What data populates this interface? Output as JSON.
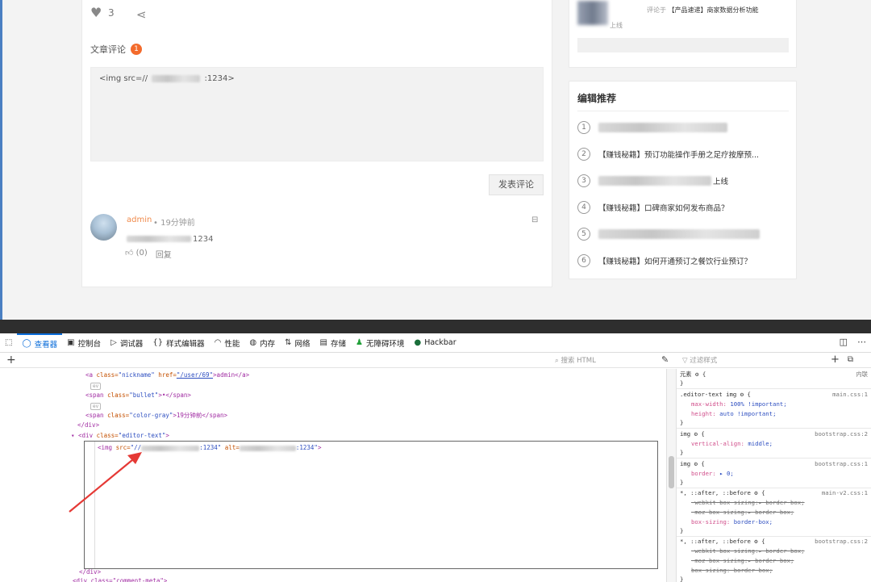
{
  "article": {
    "like_count": "3",
    "comments_title": "文章评论",
    "comments_badge": "1",
    "comment_input_prefix": "<img src=//",
    "comment_input_suffix": ":1234>",
    "submit_label": "发表评论",
    "comment": {
      "author": "admin",
      "time": "• 19分钟前",
      "text_suffix": "1234",
      "like_label": "(0)",
      "reply_label": "回复"
    }
  },
  "sidebar": {
    "recent_comment": {
      "action": "评论于",
      "link": "【产品速递】商家数据分析功能",
      "link_tail": "上线"
    },
    "recommend_title": "编辑推荐",
    "items": [
      {
        "num": "1",
        "title": ""
      },
      {
        "num": "2",
        "title": "【赚钱秘籍】预订功能操作手册之足疗按摩预..."
      },
      {
        "num": "3",
        "title": "上线"
      },
      {
        "num": "4",
        "title": "【赚钱秘籍】口碑商家如何发布商品？"
      },
      {
        "num": "5",
        "title": ""
      },
      {
        "num": "6",
        "title": "【赚钱秘籍】如何开通预订之餐饮行业预订？"
      }
    ]
  },
  "devtools": {
    "tabs": [
      {
        "icon": "inspector-icon",
        "glyph": "◯",
        "label": "查看器"
      },
      {
        "icon": "console-icon",
        "glyph": "▣",
        "label": "控制台"
      },
      {
        "icon": "debugger-icon",
        "glyph": "▷",
        "label": "调试器"
      },
      {
        "icon": "style-editor-icon",
        "glyph": "{}",
        "label": "样式编辑器"
      },
      {
        "icon": "performance-icon",
        "glyph": "◠",
        "label": "性能"
      },
      {
        "icon": "memory-icon",
        "glyph": "◍",
        "label": "内存"
      },
      {
        "icon": "network-icon",
        "glyph": "⇅",
        "label": "网络"
      },
      {
        "icon": "storage-icon",
        "glyph": "▤",
        "label": "存储"
      },
      {
        "icon": "accessibility-icon",
        "glyph": "♟",
        "label": "无障碍环境"
      },
      {
        "icon": "hackbar-icon",
        "glyph": "●",
        "label": "Hackbar"
      }
    ],
    "search_html_placeholder": "搜索 HTML",
    "filter_styles_placeholder": "过滤样式",
    "markup": {
      "l1_tag_open": "<a",
      "l1_attr1": " class=",
      "l1_val1": "\"nickname\"",
      "l1_attr2": " href=",
      "l1_val2": "\"/user/69\"",
      "l1_text": ">admin</a>",
      "ev1": "ev",
      "l2_tag": "<span",
      "l2_attr": " class=",
      "l2_val": "\"bullet\"",
      "l2_text": ">•</span>",
      "ev2": "ev",
      "l3_tag": "<span",
      "l3_attr": " class=",
      "l3_val": "\"color-gray\"",
      "l3_text": ">19分钟前</span>",
      "l4": "</div>",
      "l5_tag": "▾ <div",
      "l5_attr": " class=",
      "l5_val": "\"editor-text\"",
      "l5_end": ">",
      "img_tag": "<img",
      "img_src_attr": " src=",
      "img_src_val_a": "\"//",
      "img_src_val_b": ":1234\"",
      "img_alt_attr": " alt=",
      "img_alt_val_b": ":1234\"",
      "img_end": ">",
      "l_close": "</div>",
      "l_next": "<div class=\"comment-meta\">"
    },
    "rules": {
      "element_label": "元素",
      "element_brace": "{",
      "inline_label": "内联",
      "close": "}",
      "r1_selector": ".editor-text img",
      "r1_src": "main.css:1",
      "r1_p1_name": "max-width:",
      "r1_p1_val": "100% !important;",
      "r1_p2_name": "height:",
      "r1_p2_val": "auto !important;",
      "r2_selector": "img",
      "r2_src": "bootstrap.css:2",
      "r2_p1_name": "vertical-align:",
      "r2_p1_val": "middle;",
      "r3_selector": "img",
      "r3_src": "bootstrap.css:1",
      "r3_p1_name": "border:",
      "r3_p1_val": "▸ 0;",
      "r4_selector": "*, ::after, ::before",
      "r4_src": "main-v2.css:1",
      "r4_p1": "-webkit-box-sizing:▸ border-box;",
      "r4_p2": "-moz-box-sizing:▸ border-box;",
      "r4_p3_name": "box-sizing:",
      "r4_p3_val": "border-box;",
      "r5_selector": "*, ::after, ::before",
      "r5_src": "bootstrap.css:2",
      "r5_p1": "-webkit-box-sizing:▸ border-box;",
      "r5_p2": "-moz-box-sizing:▸ border-box;",
      "r5_p3": "box-sizing:-border-box;"
    }
  },
  "colors": {
    "accent_blue": "#0a6cd9",
    "comment_badge": "#f36b2c",
    "admin_name": "#f08a4b",
    "arrow_red": "#e53935"
  }
}
